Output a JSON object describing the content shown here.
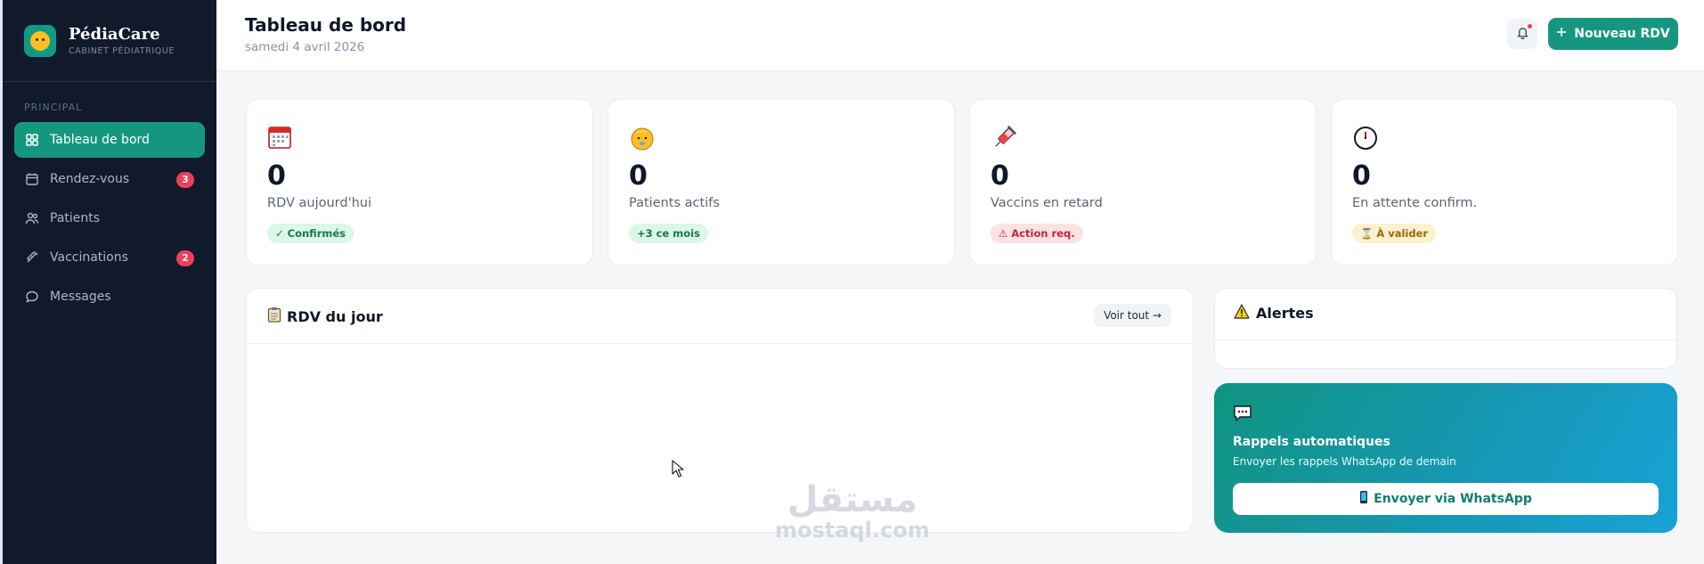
{
  "brand": {
    "name": "PédiaCare",
    "subtitle": "CABINET PÉDIATRIQUE"
  },
  "sidebar": {
    "section_label": "PRINCIPAL",
    "items": [
      {
        "label": "Tableau de bord",
        "icon": "grid-icon",
        "active": true
      },
      {
        "label": "Rendez-vous",
        "icon": "calendar-icon",
        "badge": "3"
      },
      {
        "label": "Patients",
        "icon": "users-icon"
      },
      {
        "label": "Vaccinations",
        "icon": "syringe-icon",
        "badge": "2"
      },
      {
        "label": "Messages",
        "icon": "chat-icon"
      }
    ]
  },
  "header": {
    "title": "Tableau de bord",
    "date": "samedi 4 avril 2026",
    "new_button": "Nouveau RDV"
  },
  "stats": [
    {
      "icon": "calendar-icon",
      "value": "0",
      "label": "RDV aujourd'hui",
      "tag": "✓ Confirmés",
      "tag_color": "#157a49"
    },
    {
      "icon": "baby-face-icon",
      "value": "0",
      "label": "Patients actifs",
      "tag": "+3 ce mois",
      "tag_color": "#157a49"
    },
    {
      "icon": "syringe-icon",
      "value": "0",
      "label": "Vaccins en retard",
      "tag": "⚠ Action req.",
      "tag_color": "#c0263a"
    },
    {
      "icon": "clock-icon",
      "value": "0",
      "label": "En attente confirm.",
      "tag": "⌛ À valider",
      "tag_color": "#9a6a06"
    }
  ],
  "rdv_panel": {
    "title": "RDV du jour",
    "see_all": "Voir tout →"
  },
  "alerts_panel": {
    "title": "Alertes"
  },
  "reminders": {
    "title": "Rappels automatiques",
    "subtitle": "Envoyer les rappels WhatsApp de demain",
    "button": "Envoyer via WhatsApp"
  },
  "watermark": {
    "arabic": "مستقل",
    "url": "mostaql.com"
  },
  "colors": {
    "accent": "#15977f",
    "sidebar_bg": "#111a2b",
    "badge": "#ef3f5a"
  }
}
